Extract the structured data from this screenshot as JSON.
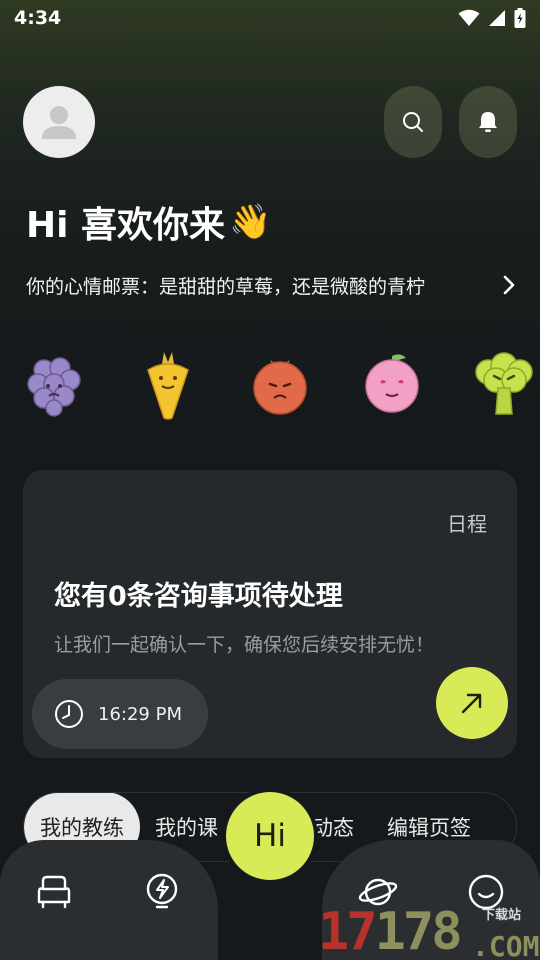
{
  "status_bar": {
    "time": "4:34"
  },
  "header": {
    "greeting": "Hi 喜欢你来",
    "greeting_emoji": "👋",
    "mood_prompt": "你的心情邮票：是甜甜的草莓，还是微酸的青柠"
  },
  "mood_stamps": [
    "grape",
    "carrot",
    "tomato",
    "peach",
    "broccoli"
  ],
  "card": {
    "tag": "日程",
    "title": "您有0条咨询事项待处理",
    "subtitle": "让我们一起确认一下，确保您后续安排无忧！",
    "time": "16:29 PM"
  },
  "tabs": [
    "我的教练",
    "我的课",
    "的动态",
    "编辑页签"
  ],
  "center_button": "Hi",
  "watermark": {
    "number_red": "17",
    "number_olive": "178",
    "domain": ".COM",
    "caption": "下载站"
  },
  "colors": {
    "accent": "#d9ea57",
    "background": "#15191b",
    "card": "#25292b"
  }
}
